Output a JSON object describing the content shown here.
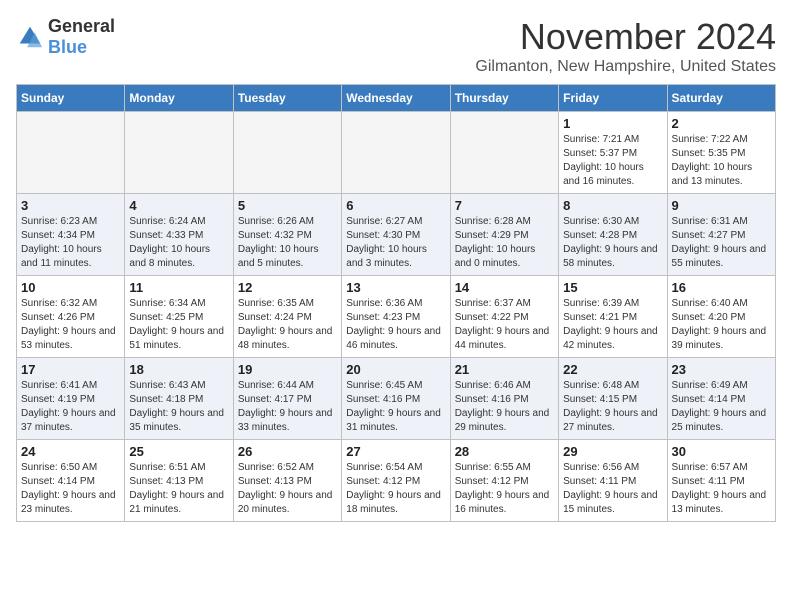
{
  "logo": {
    "general": "General",
    "blue": "Blue"
  },
  "header": {
    "month": "November 2024",
    "location": "Gilmanton, New Hampshire, United States"
  },
  "weekdays": [
    "Sunday",
    "Monday",
    "Tuesday",
    "Wednesday",
    "Thursday",
    "Friday",
    "Saturday"
  ],
  "weeks": [
    [
      {
        "day": null
      },
      {
        "day": null
      },
      {
        "day": null
      },
      {
        "day": null
      },
      {
        "day": null
      },
      {
        "day": "1",
        "sunrise": "Sunrise: 7:21 AM",
        "sunset": "Sunset: 5:37 PM",
        "daylight": "Daylight: 10 hours and 16 minutes."
      },
      {
        "day": "2",
        "sunrise": "Sunrise: 7:22 AM",
        "sunset": "Sunset: 5:35 PM",
        "daylight": "Daylight: 10 hours and 13 minutes."
      }
    ],
    [
      {
        "day": "3",
        "sunrise": "Sunrise: 6:23 AM",
        "sunset": "Sunset: 4:34 PM",
        "daylight": "Daylight: 10 hours and 11 minutes."
      },
      {
        "day": "4",
        "sunrise": "Sunrise: 6:24 AM",
        "sunset": "Sunset: 4:33 PM",
        "daylight": "Daylight: 10 hours and 8 minutes."
      },
      {
        "day": "5",
        "sunrise": "Sunrise: 6:26 AM",
        "sunset": "Sunset: 4:32 PM",
        "daylight": "Daylight: 10 hours and 5 minutes."
      },
      {
        "day": "6",
        "sunrise": "Sunrise: 6:27 AM",
        "sunset": "Sunset: 4:30 PM",
        "daylight": "Daylight: 10 hours and 3 minutes."
      },
      {
        "day": "7",
        "sunrise": "Sunrise: 6:28 AM",
        "sunset": "Sunset: 4:29 PM",
        "daylight": "Daylight: 10 hours and 0 minutes."
      },
      {
        "day": "8",
        "sunrise": "Sunrise: 6:30 AM",
        "sunset": "Sunset: 4:28 PM",
        "daylight": "Daylight: 9 hours and 58 minutes."
      },
      {
        "day": "9",
        "sunrise": "Sunrise: 6:31 AM",
        "sunset": "Sunset: 4:27 PM",
        "daylight": "Daylight: 9 hours and 55 minutes."
      }
    ],
    [
      {
        "day": "10",
        "sunrise": "Sunrise: 6:32 AM",
        "sunset": "Sunset: 4:26 PM",
        "daylight": "Daylight: 9 hours and 53 minutes."
      },
      {
        "day": "11",
        "sunrise": "Sunrise: 6:34 AM",
        "sunset": "Sunset: 4:25 PM",
        "daylight": "Daylight: 9 hours and 51 minutes."
      },
      {
        "day": "12",
        "sunrise": "Sunrise: 6:35 AM",
        "sunset": "Sunset: 4:24 PM",
        "daylight": "Daylight: 9 hours and 48 minutes."
      },
      {
        "day": "13",
        "sunrise": "Sunrise: 6:36 AM",
        "sunset": "Sunset: 4:23 PM",
        "daylight": "Daylight: 9 hours and 46 minutes."
      },
      {
        "day": "14",
        "sunrise": "Sunrise: 6:37 AM",
        "sunset": "Sunset: 4:22 PM",
        "daylight": "Daylight: 9 hours and 44 minutes."
      },
      {
        "day": "15",
        "sunrise": "Sunrise: 6:39 AM",
        "sunset": "Sunset: 4:21 PM",
        "daylight": "Daylight: 9 hours and 42 minutes."
      },
      {
        "day": "16",
        "sunrise": "Sunrise: 6:40 AM",
        "sunset": "Sunset: 4:20 PM",
        "daylight": "Daylight: 9 hours and 39 minutes."
      }
    ],
    [
      {
        "day": "17",
        "sunrise": "Sunrise: 6:41 AM",
        "sunset": "Sunset: 4:19 PM",
        "daylight": "Daylight: 9 hours and 37 minutes."
      },
      {
        "day": "18",
        "sunrise": "Sunrise: 6:43 AM",
        "sunset": "Sunset: 4:18 PM",
        "daylight": "Daylight: 9 hours and 35 minutes."
      },
      {
        "day": "19",
        "sunrise": "Sunrise: 6:44 AM",
        "sunset": "Sunset: 4:17 PM",
        "daylight": "Daylight: 9 hours and 33 minutes."
      },
      {
        "day": "20",
        "sunrise": "Sunrise: 6:45 AM",
        "sunset": "Sunset: 4:16 PM",
        "daylight": "Daylight: 9 hours and 31 minutes."
      },
      {
        "day": "21",
        "sunrise": "Sunrise: 6:46 AM",
        "sunset": "Sunset: 4:16 PM",
        "daylight": "Daylight: 9 hours and 29 minutes."
      },
      {
        "day": "22",
        "sunrise": "Sunrise: 6:48 AM",
        "sunset": "Sunset: 4:15 PM",
        "daylight": "Daylight: 9 hours and 27 minutes."
      },
      {
        "day": "23",
        "sunrise": "Sunrise: 6:49 AM",
        "sunset": "Sunset: 4:14 PM",
        "daylight": "Daylight: 9 hours and 25 minutes."
      }
    ],
    [
      {
        "day": "24",
        "sunrise": "Sunrise: 6:50 AM",
        "sunset": "Sunset: 4:14 PM",
        "daylight": "Daylight: 9 hours and 23 minutes."
      },
      {
        "day": "25",
        "sunrise": "Sunrise: 6:51 AM",
        "sunset": "Sunset: 4:13 PM",
        "daylight": "Daylight: 9 hours and 21 minutes."
      },
      {
        "day": "26",
        "sunrise": "Sunrise: 6:52 AM",
        "sunset": "Sunset: 4:13 PM",
        "daylight": "Daylight: 9 hours and 20 minutes."
      },
      {
        "day": "27",
        "sunrise": "Sunrise: 6:54 AM",
        "sunset": "Sunset: 4:12 PM",
        "daylight": "Daylight: 9 hours and 18 minutes."
      },
      {
        "day": "28",
        "sunrise": "Sunrise: 6:55 AM",
        "sunset": "Sunset: 4:12 PM",
        "daylight": "Daylight: 9 hours and 16 minutes."
      },
      {
        "day": "29",
        "sunrise": "Sunrise: 6:56 AM",
        "sunset": "Sunset: 4:11 PM",
        "daylight": "Daylight: 9 hours and 15 minutes."
      },
      {
        "day": "30",
        "sunrise": "Sunrise: 6:57 AM",
        "sunset": "Sunset: 4:11 PM",
        "daylight": "Daylight: 9 hours and 13 minutes."
      }
    ]
  ]
}
